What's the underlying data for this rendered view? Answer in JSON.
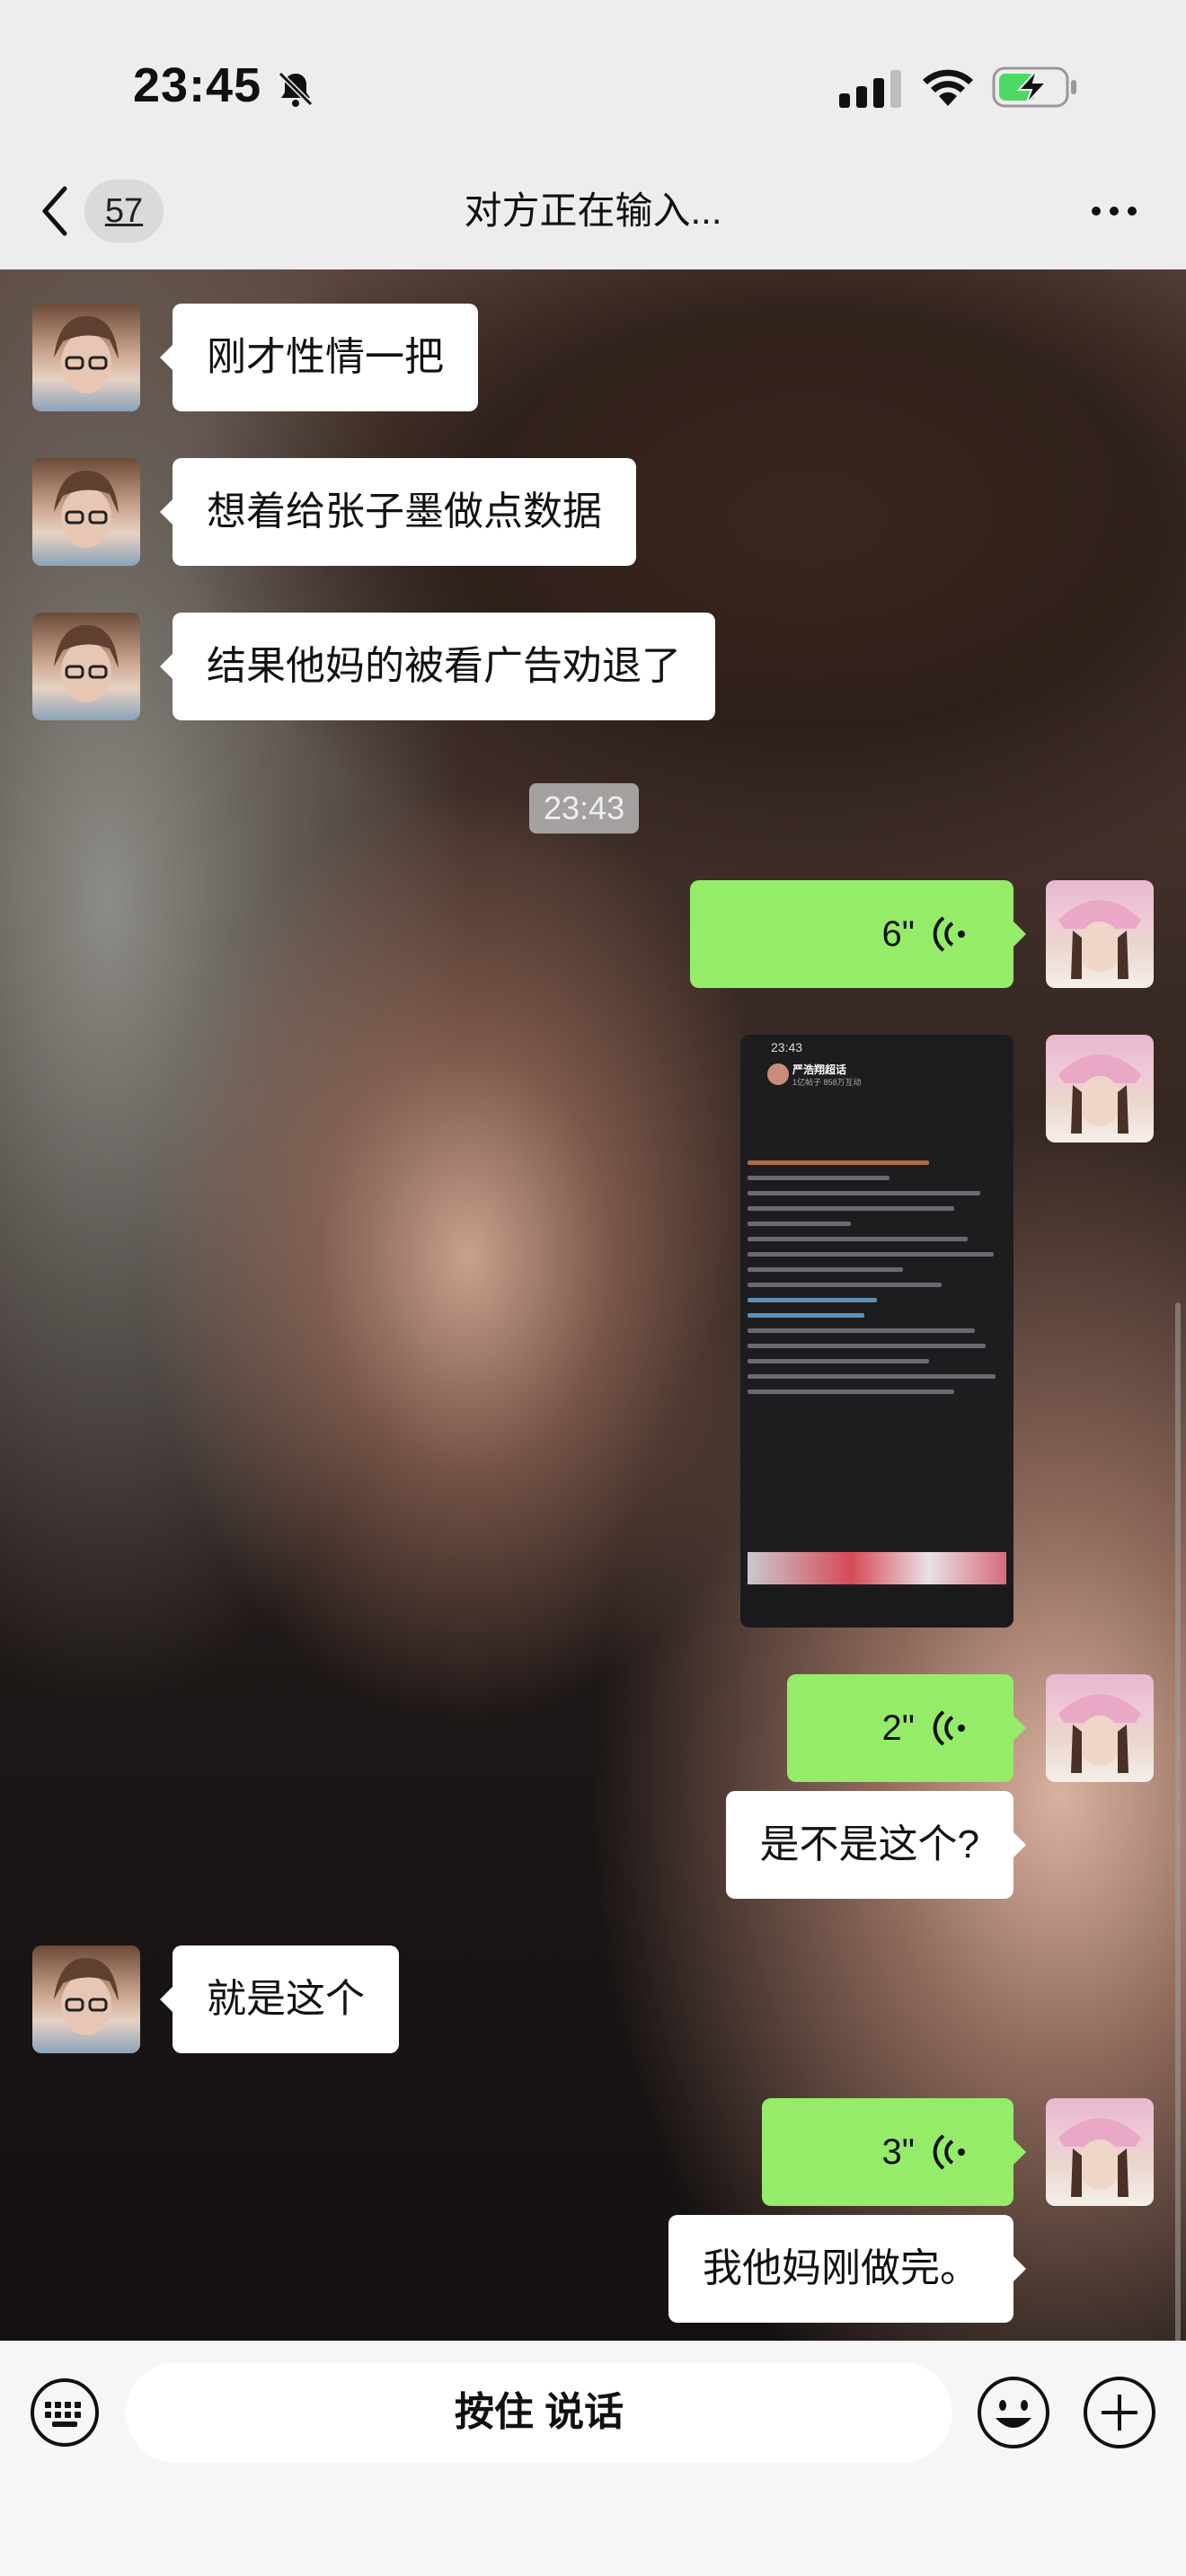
{
  "status_bar": {
    "time": "23:45",
    "icons": [
      "bell-slash-icon",
      "cellular-signal-icon",
      "wifi-icon",
      "battery-charging-icon"
    ]
  },
  "nav": {
    "unread_count": "57",
    "title": "对方正在输入...",
    "icons": [
      "chevron-left-icon",
      "more-dots-icon"
    ]
  },
  "messages": [
    {
      "side": "left",
      "type": "text",
      "text": "刚才性情一把"
    },
    {
      "side": "left",
      "type": "text",
      "text": "想着给张子墨做点数据"
    },
    {
      "side": "left",
      "type": "text",
      "text": "结果他妈的被看广告劝退了"
    },
    {
      "type": "time",
      "text": "23:43"
    },
    {
      "side": "right",
      "type": "voice",
      "duration": "6\""
    },
    {
      "side": "right",
      "type": "image",
      "shot": {
        "time": "23:43",
        "title": "严浩翔超话",
        "subtitle": "1亿帖子 858万互动"
      }
    },
    {
      "side": "right",
      "type": "voice",
      "duration": "2\""
    },
    {
      "side": "right",
      "type": "text",
      "text": "是不是这个?"
    },
    {
      "side": "left",
      "type": "text",
      "text": "就是这个"
    },
    {
      "side": "right",
      "type": "voice",
      "duration": "3\""
    },
    {
      "side": "right",
      "type": "text",
      "text": "我他妈刚做完。"
    }
  ],
  "input_bar": {
    "hold_to_talk_label": "按住 说话",
    "icons": [
      "keyboard-icon",
      "emoji-icon",
      "plus-icon"
    ]
  },
  "colors": {
    "sent_bubble": "#95ec69",
    "received_bubble": "#ffffff",
    "app_bar": "#ededed"
  }
}
